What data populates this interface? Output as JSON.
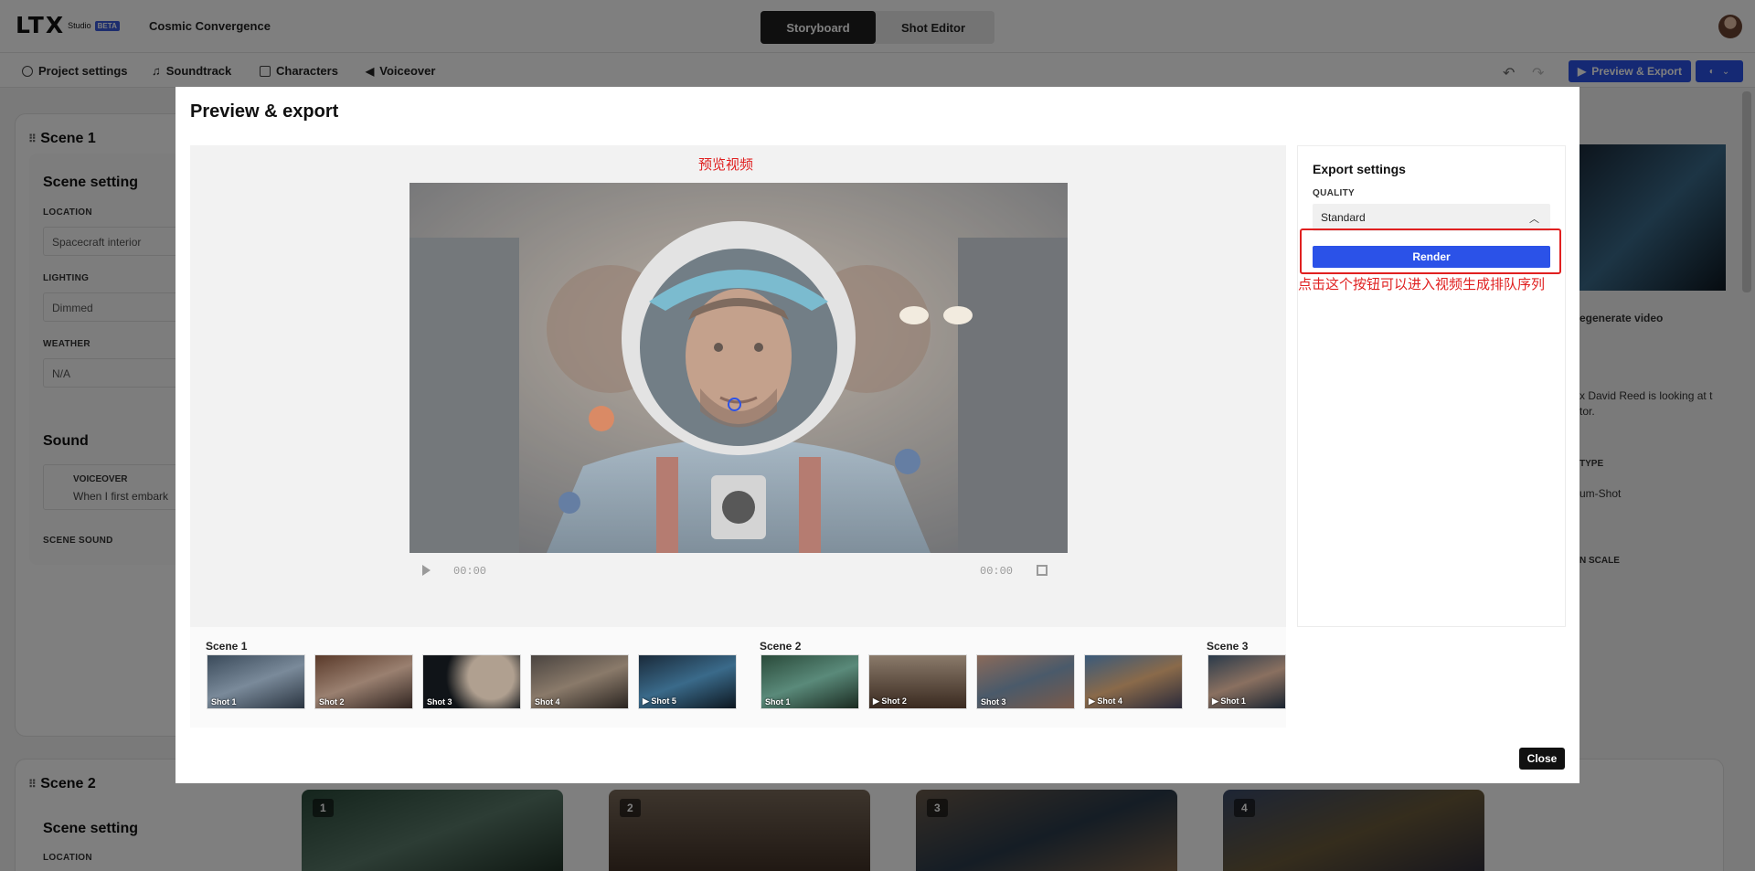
{
  "app": {
    "logo": "LTX",
    "logo_sub": "Studio",
    "badge": "BETA",
    "project_title": "Cosmic Convergence",
    "modes": [
      "Storyboard",
      "Shot Editor"
    ]
  },
  "toolbar": {
    "project_settings": "Project settings",
    "soundtrack": "Soundtrack",
    "characters": "Characters",
    "voiceover": "Voiceover",
    "preview_export": "Preview & Export"
  },
  "background": {
    "scene1": {
      "title": "Scene 1",
      "setting_title": "Scene setting",
      "location_label": "LOCATION",
      "location_value": "Spacecraft interior",
      "lighting_label": "LIGHTING",
      "lighting_value": "Dimmed",
      "weather_label": "WEATHER",
      "weather_value": "N/A",
      "sound_title": "Sound",
      "voiceover_label": "VOICEOVER",
      "voiceover_text": "When I first embark",
      "scene_sound_label": "SCENE SOUND"
    },
    "scene2": {
      "title": "Scene 2",
      "setting_title": "Scene setting",
      "location_label": "LOCATION"
    },
    "thumb_numbers": [
      "1",
      "2",
      "3",
      "4"
    ],
    "right": {
      "regen": "egenerate video",
      "character_line": "x David Reed  is looking at t",
      "character_line2": "tor.",
      "type_label": "TYPE",
      "type_value": "um-Shot",
      "scale_label": "N SCALE"
    }
  },
  "modal": {
    "title": "Preview & export",
    "preview_caption": "预览视频",
    "time_current": "00:00",
    "time_total": "00:00",
    "shots": {
      "scene1": {
        "label": "Scene 1",
        "items": [
          "Shot 1",
          "Shot 2",
          "Shot 3",
          "Shot 4",
          "▶ Shot 5"
        ]
      },
      "scene2": {
        "label": "Scene 2",
        "items": [
          "Shot 1",
          "▶ Shot 2",
          "Shot 3",
          "▶ Shot 4"
        ]
      },
      "scene3": {
        "label": "Scene 3",
        "items": [
          "▶ Shot 1"
        ]
      }
    },
    "export": {
      "title": "Export settings",
      "quality_label": "QUALITY",
      "quality_value": "Standard",
      "render_label": "Render",
      "annotation": "点击这个按钮可以进入视频生成排队序列"
    },
    "close_label": "Close"
  },
  "colors": {
    "accent": "#2b52e8",
    "annotation_red": "#e02020"
  }
}
